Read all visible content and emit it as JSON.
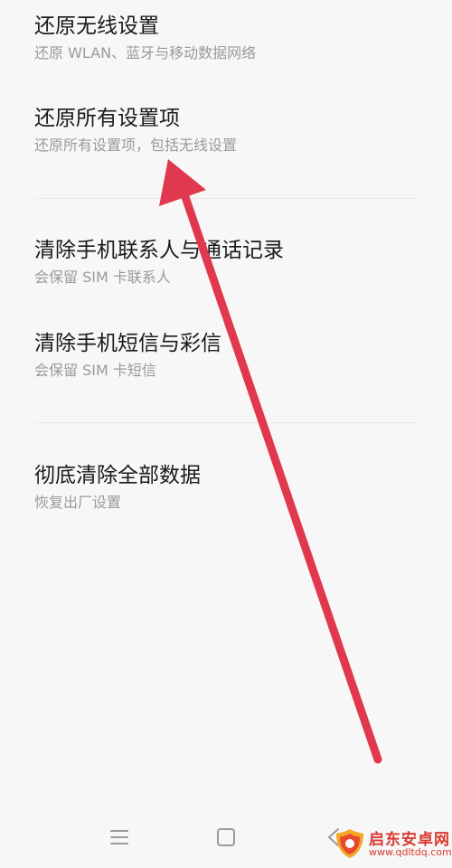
{
  "settings": {
    "items": [
      {
        "title": "还原无线设置",
        "subtitle": "还原 WLAN、蓝牙与移动数据网络"
      },
      {
        "title": "还原所有设置项",
        "subtitle": "还原所有设置项，包括无线设置"
      },
      {
        "title": "清除手机联系人与通话记录",
        "subtitle": "会保留 SIM 卡联系人"
      },
      {
        "title": "清除手机短信与彩信",
        "subtitle": "会保留 SIM 卡短信"
      },
      {
        "title": "彻底清除全部数据",
        "subtitle": "恢复出厂设置"
      }
    ]
  },
  "navbar": {
    "menu_icon": "menu-icon",
    "home_icon": "home-icon",
    "back_icon": "back-icon"
  },
  "annotation": {
    "arrow_color": "#e0384e"
  },
  "watermark": {
    "name": "启东安卓网",
    "url": "www.qdltdq.com",
    "color": "#d9392f"
  },
  "colors": {
    "background": "#f7f7f7",
    "title_text": "#1a1a1a",
    "subtitle_text": "#9a9a9a",
    "divider": "#e8e8e8"
  }
}
